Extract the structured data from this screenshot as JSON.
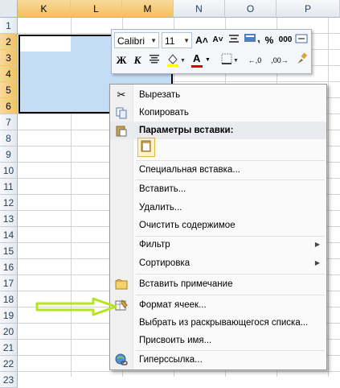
{
  "sheet": {
    "columns": [
      "K",
      "L",
      "M",
      "N",
      "O",
      "P"
    ],
    "rows": [
      "1",
      "2",
      "3",
      "4",
      "5",
      "6",
      "7",
      "8",
      "9",
      "10",
      "11",
      "12",
      "13",
      "14",
      "15",
      "16",
      "17",
      "18",
      "19",
      "20",
      "21",
      "22",
      "23"
    ],
    "selection_fill": "#c5dcf5"
  },
  "mini_toolbar": {
    "font_name": "Calibri",
    "font_size": "11",
    "grow_font": "A˄",
    "shrink_font": "A˅",
    "percent": "%",
    "thousands": "000",
    "bold": "Ж",
    "italic": "К",
    "font_color_letter": "A",
    "increase_decimal": "←,0",
    "decrease_decimal": ",00→"
  },
  "context_menu": {
    "cut": "Вырезать",
    "copy": "Копировать",
    "paste_options": "Параметры вставки:",
    "paste_special": "Специальная вставка...",
    "insert": "Вставить...",
    "delete": "Удалить...",
    "clear_contents": "Очистить содержимое",
    "filter": "Фильтр",
    "sort": "Сортировка",
    "insert_comment": "Вставить примечание",
    "format_cells": "Формат ячеек...",
    "pick_from_list": "Выбрать из раскрывающегося списка...",
    "define_name": "Присвоить имя...",
    "hyperlink": "Гиперссылка..."
  },
  "annotation_arrow_color": "#b5e61d"
}
